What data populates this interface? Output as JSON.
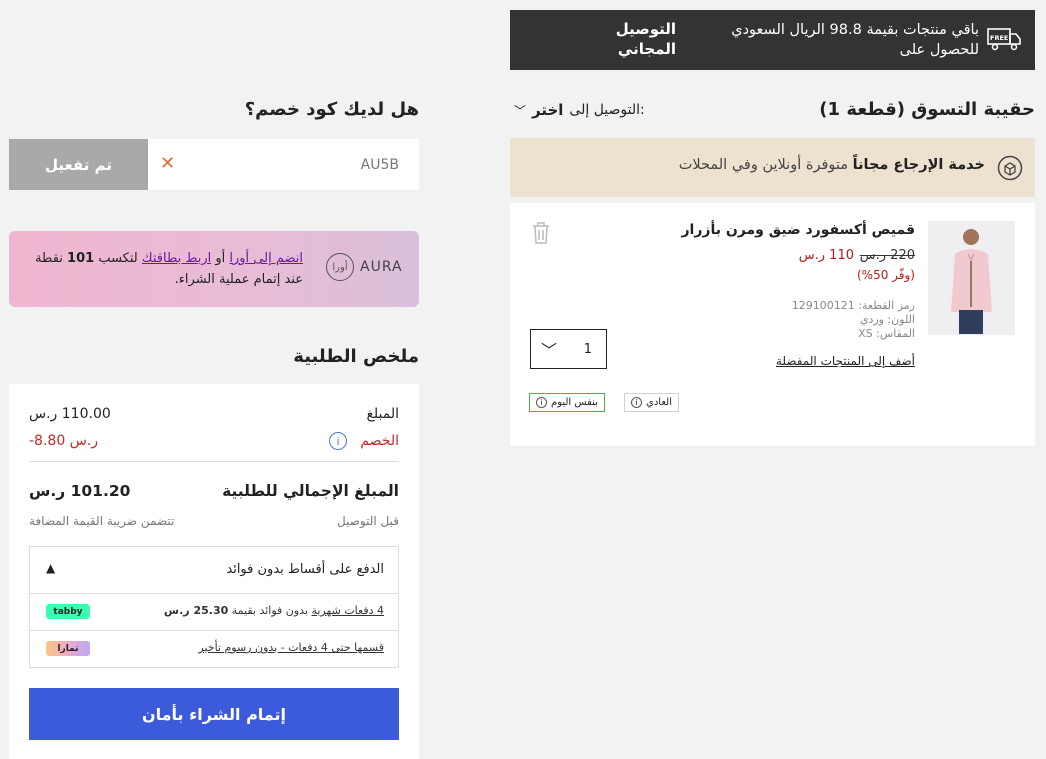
{
  "free_delivery": {
    "title": "التوصيل المجاني",
    "message": "باقي منتجات بقيمة 98.8 الريال السعودي للحصول على",
    "icon": "free-delivery-truck-icon",
    "icon_label": "FREE"
  },
  "bag": {
    "title": "حقيبة التسوق (قطعة 1)",
    "delivery_label": "التوصيل إلى:",
    "delivery_value": "اختر"
  },
  "return_service": {
    "bold": "خدمة الإرجاع مجاناً",
    "text": "متوفرة أونلاين وفي المحلات"
  },
  "product": {
    "name": "قميص أكسفورد ضيق ومرن بأزرار",
    "price_old": "220 ر.س",
    "price_new": "110 ر.س",
    "saving": "(وفّر 50%)",
    "sku_label": "رمز القطعة: 129100121",
    "color_label": "اللون: وردي",
    "size_label": "المقاس: XS",
    "add_to_favorites": "أضف إلى المنتجات المفضلة",
    "quantity": "1",
    "tag_normal": "العادي",
    "tag_sameday": "بنفس اليوم"
  },
  "promo": {
    "title": "هل لديك كود خصم؟",
    "code": "AU5B",
    "button": "تم تفعيل"
  },
  "aura": {
    "logo": "AURA",
    "logo_circle": "أورا",
    "join_link": "انضم إلى أورا",
    "or": "أو",
    "link_card": "اربط بطاقتك",
    "text_a": "لتكسب",
    "points": "101",
    "text_b": "نقطة عند إتمام عملية الشراء."
  },
  "summary": {
    "title": "ملخص الطلبية",
    "amount_label": "المبلغ",
    "amount_value": "110.00 ر.س",
    "discount_label": "الخصم",
    "discount_value": "-8.80 ر.س",
    "total_label": "المبلغ الإجمالي للطلبية",
    "total_value": "101.20 ر.س",
    "delivery_note": "قبل التوصيل",
    "vat_note": "تتضمن ضريبة القيمة المضافة"
  },
  "installments": {
    "title": "الدفع على أقساط بدون فوائد",
    "tabby_text": "4 دفعات شهرية",
    "tabby_text2": "بدون فوائد بقيمة",
    "tabby_amount": "25.30 ر.س",
    "tabby_badge": "tabby",
    "tamara_text": "قسمها حتى 4 دفعات - بدون رسوم تأخير",
    "tamara_badge": "تمارا"
  },
  "checkout": {
    "button": "إتمام الشراء بأمان"
  },
  "colors": {
    "banner_bg": "#333333",
    "return_bg": "#ece2cf",
    "checkout_bg": "#3b5bdb",
    "discount": "#c62828"
  }
}
